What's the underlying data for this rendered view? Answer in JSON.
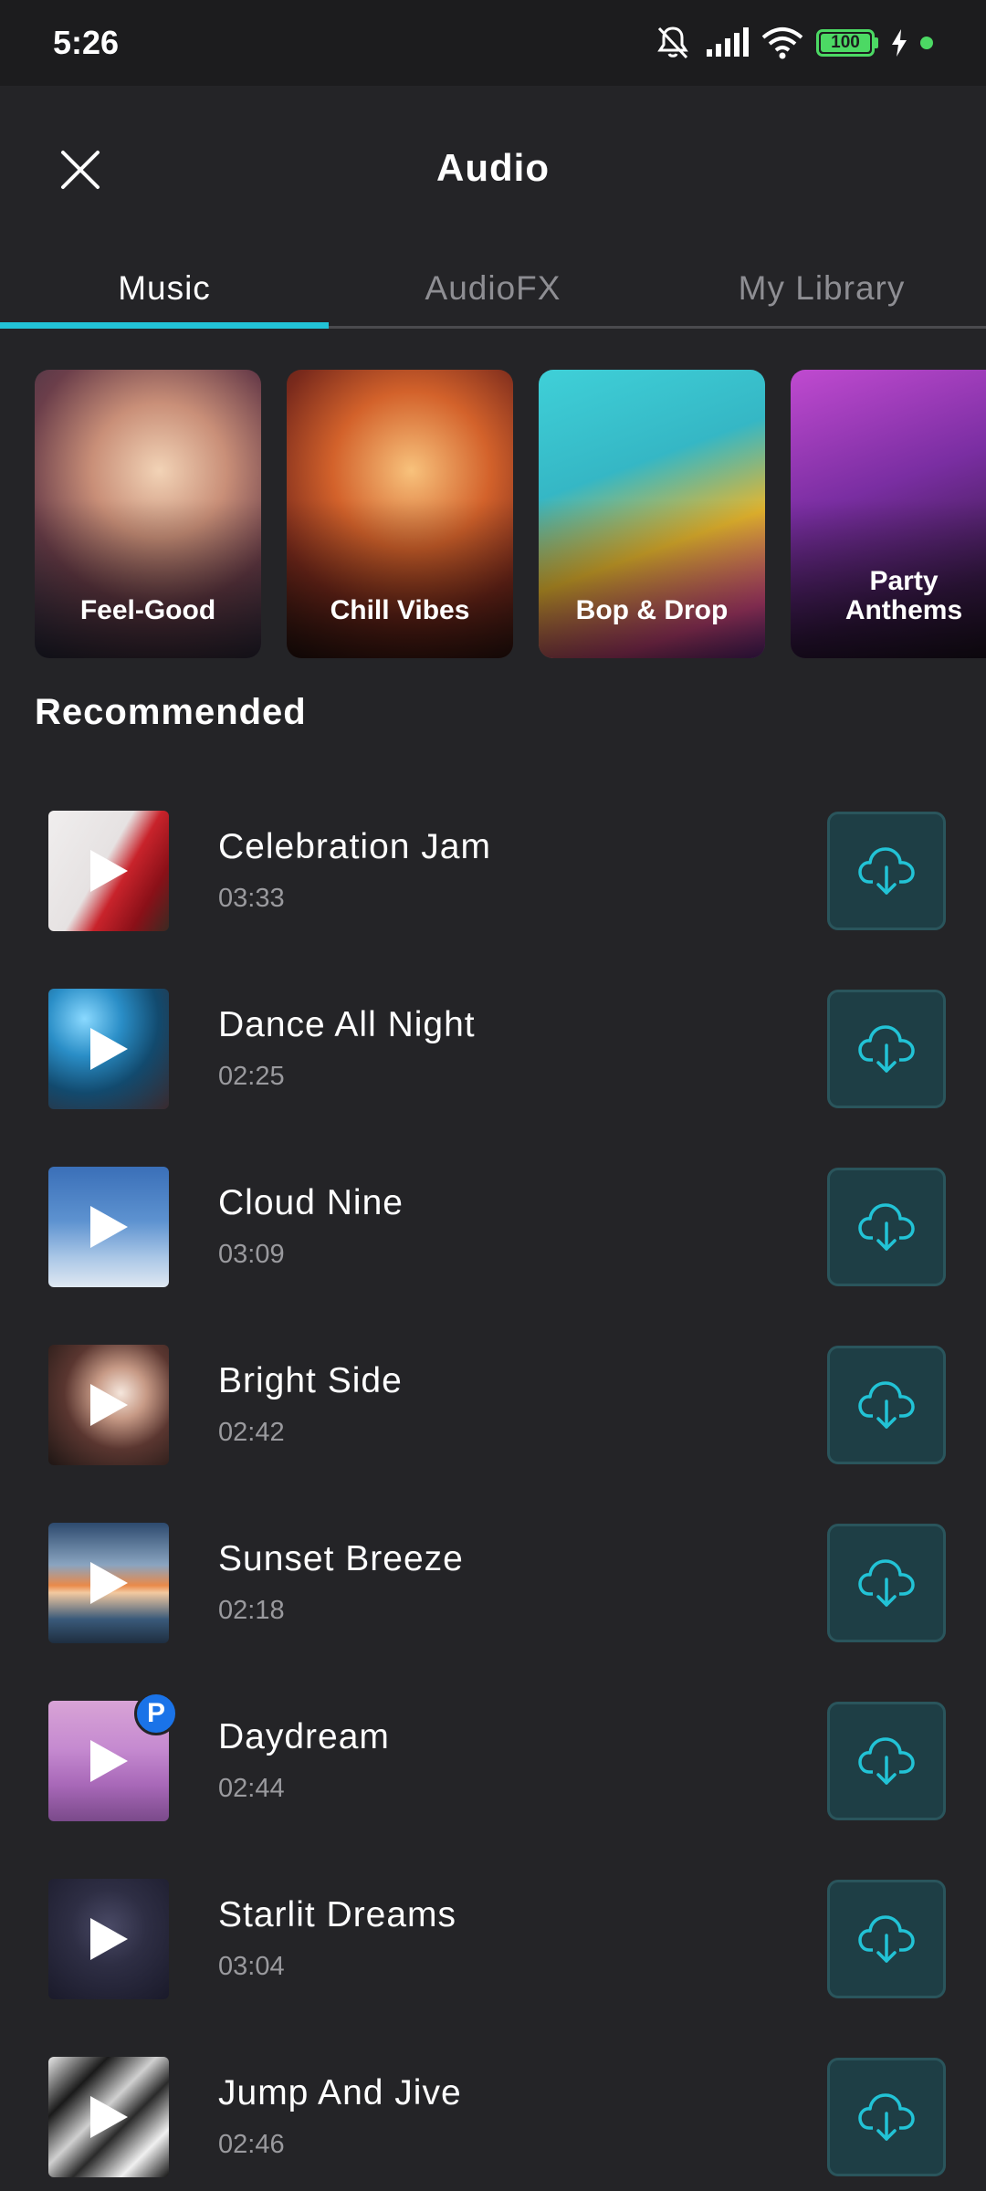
{
  "status_bar": {
    "time": "5:26",
    "battery": "100",
    "icons": [
      "mute-bell-icon",
      "signal-icon",
      "wifi-icon",
      "battery-icon",
      "charging-bolt-icon"
    ]
  },
  "header": {
    "title": "Audio",
    "close_icon": "close-icon"
  },
  "tabs": [
    {
      "label": "Music",
      "active": true
    },
    {
      "label": "AudioFX",
      "active": false
    },
    {
      "label": "My Library",
      "active": false
    }
  ],
  "categories": [
    {
      "label": "Feel-Good"
    },
    {
      "label": "Chill Vibes"
    },
    {
      "label": "Bop & Drop"
    },
    {
      "label": "Party Anthems"
    }
  ],
  "recommended": {
    "title": "Recommended",
    "tracks": [
      {
        "title": "Celebration Jam",
        "duration": "03:33",
        "premium": false
      },
      {
        "title": "Dance All Night",
        "duration": "02:25",
        "premium": false
      },
      {
        "title": "Cloud Nine",
        "duration": "03:09",
        "premium": false
      },
      {
        "title": "Bright Side",
        "duration": "02:42",
        "premium": false
      },
      {
        "title": "Sunset Breeze",
        "duration": "02:18",
        "premium": false
      },
      {
        "title": "Daydream",
        "duration": "02:44",
        "premium": true,
        "badge": "P"
      },
      {
        "title": "Starlit Dreams",
        "duration": "03:04",
        "premium": false
      },
      {
        "title": "Jump And Jive",
        "duration": "02:46",
        "premium": false
      }
    ]
  },
  "colors": {
    "background": "#242427",
    "accent": "#22c3d6",
    "download_bg": "#1e3e45",
    "premium_badge": "#1a73e8"
  }
}
